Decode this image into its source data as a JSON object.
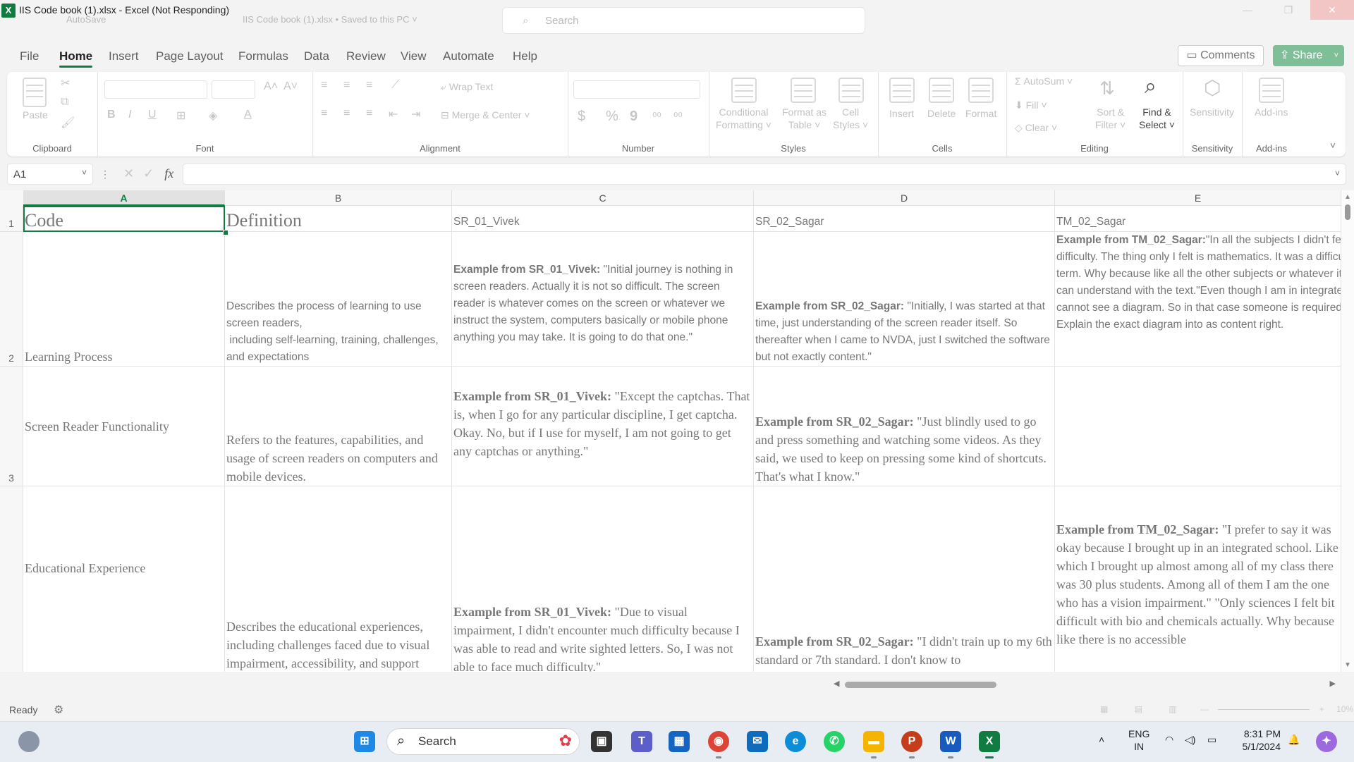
{
  "window": {
    "title": "IIS Code book (1).xlsx  -  Excel (Not Responding)",
    "app_icon_letter": "X",
    "ghost_autosave": "AutoSave",
    "ghost_filename": "IIS Code book (1).xlsx • Saved to this PC ˅",
    "ghost_search": "Search",
    "minimize": "—",
    "maximize": "❐",
    "close": "✕"
  },
  "menu": {
    "tabs": [
      "File",
      "Home",
      "Insert",
      "Page Layout",
      "Formulas",
      "Data",
      "Review",
      "View",
      "Automate",
      "Help"
    ],
    "active": "Home",
    "comments_label": "Comments",
    "share_label": "Share"
  },
  "ribbon": {
    "clipboard": {
      "label": "Clipboard",
      "paste": "Paste"
    },
    "font": {
      "label": "Font",
      "bold": "B",
      "italic": "I",
      "underline": "U"
    },
    "alignment": {
      "label": "Alignment",
      "wrap_text": "Wrap Text",
      "merge_center": "Merge & Center"
    },
    "number": {
      "label": "Number",
      "currency": "$",
      "percent": "%",
      "comma": "9"
    },
    "styles": {
      "label": "Styles",
      "conditional": "Conditional\nFormatting ˅",
      "format_table": "Format as\nTable ˅",
      "cell_styles": "Cell\nStyles ˅"
    },
    "cells": {
      "label": "Cells",
      "insert": "Insert",
      "delete": "Delete",
      "format": "Format"
    },
    "editing": {
      "label": "Editing",
      "autosum": "AutoSum ˅",
      "fill": "Fill ˅",
      "clear": "Clear ˅",
      "sort_filter": "Sort &\nFilter ˅",
      "find_select": "Find &\nSelect ˅"
    },
    "sensitivity": {
      "label": "Sensitivity",
      "btn": "Sensitivity"
    },
    "addins": {
      "label": "Add-ins",
      "btn": "Add-ins"
    }
  },
  "formula_bar": {
    "name_box": "A1",
    "fx": "fx",
    "value": ""
  },
  "grid": {
    "columns": [
      "A",
      "B",
      "C",
      "D",
      "E"
    ],
    "selected_column": "A",
    "rows": [
      {
        "num": "1",
        "cells": [
          {
            "text": "Code"
          },
          {
            "text": "Definition"
          },
          {
            "text": "SR_01_Vivek"
          },
          {
            "text": "SR_02_Sagar"
          },
          {
            "text": "TM_02_Sagar"
          }
        ]
      },
      {
        "num": "2",
        "cells": [
          {
            "text": "Learning Process"
          },
          {
            "text": "Describes the process of learning to use screen readers,\n including self-learning, training, challenges, and expectations"
          },
          {
            "lead": "Example from SR_01_Vivek:",
            "text": " \"Initial journey is nothing in screen readers. Actually it is not so difficult. The screen reader is whatever comes on the screen or whatever we instruct the system, computers basically or mobile phone anything you may take. It is going to do that one.\""
          },
          {
            "lead": "Example from SR_02_Sagar:",
            "text": " \"Initially, I was started at that time, just understanding of the screen reader itself. So thereafter when I came to NVDA, just I switched the software but not exactly content.\""
          },
          {
            "lead": "Example from TM_02_Sagar:",
            "text": "\"In all the subjects I didn't feel much difficulty. The thing only I felt is mathematics. It was a difficulty for me in my term. Why because like all the other subjects or whatever it might be. We can understand with the text.\"Even though I am in integrated. So that I cannot see a diagram. So in that case someone is required for sure to. Explain the exact diagram into as content right."
          }
        ]
      },
      {
        "num": "3",
        "cells": [
          {
            "text": "Screen Reader Functionality"
          },
          {
            "text": "Refers to the features, capabilities, and usage of screen readers on computers and mobile devices."
          },
          {
            "lead": "Example from SR_01_Vivek:",
            "text": " \"Except the captchas. That is, when I go for any particular discipline, I get captcha. Okay. No, but if I use for myself, I am not going to get any captchas or anything.\""
          },
          {
            "lead": "Example from SR_02_Sagar:",
            "text": " \"Just blindly used to go and press something and watching some videos. As they said, we used to keep on pressing some kind of shortcuts. That's what I know.\""
          },
          {
            "text": ""
          }
        ]
      },
      {
        "num": "",
        "cells": [
          {
            "text": "Educational Experience"
          },
          {
            "text": "Describes the educational experiences, including challenges faced due to visual impairment, accessibility, and support"
          },
          {
            "lead": "Example from SR_01_Vivek:",
            "text": " \"Due to visual impairment, I didn't encounter much difficulty because I was able to read and write sighted letters. So, I was not able to face much difficulty.\""
          },
          {
            "lead": "Example from SR_02_Sagar:",
            "text": " \"I didn't train up to my 6th standard or 7th standard. I don't know to"
          },
          {
            "lead": "Example from TM_02_Sagar:",
            "text": " \"I prefer to say it was okay because I brought up in an integrated school. Like which I brought up almost among all of my class there was 30 plus students. Among all of them I am the one who has a vision impairment.\" \"Only sciences I felt bit difficult with bio and chemicals actually. Why because like there is no accessible"
          }
        ]
      }
    ]
  },
  "status": {
    "ready": "Ready",
    "zoom": "10%"
  },
  "taskbar": {
    "search_label": "Search",
    "lang_top": "ENG",
    "lang_bottom": "IN",
    "time": "8:31 PM",
    "date": "5/1/2024"
  }
}
